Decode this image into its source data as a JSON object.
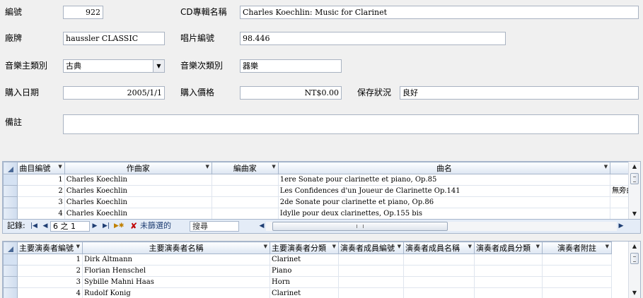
{
  "form": {
    "id_label": "編號",
    "id_value": "922",
    "album_label": "CD專輯名稱",
    "album_value": "Charles Koechlin: Music for Clarinet",
    "label_label": "廠牌",
    "label_value": "haussler CLASSIC",
    "catalog_label": "唱片編號",
    "catalog_value": "98.446",
    "genre_label": "音樂主類別",
    "genre_value": "古典",
    "subgenre_label": "音樂次類別",
    "subgenre_value": "器樂",
    "date_label": "購入日期",
    "date_value": "2005/1/1",
    "price_label": "購入價格",
    "price_value": "NT$0.00",
    "condition_label": "保存狀況",
    "condition_value": "良好",
    "notes_label": "備註",
    "notes_value": ""
  },
  "tracks": {
    "columns": [
      "曲目編號",
      "作曲家",
      "編曲家",
      "曲名",
      ""
    ],
    "rows": [
      {
        "no": "1",
        "composer": "Charles Koechlin",
        "arranger": "",
        "title": "1ere Sonate pour clarinette et piano, Op.85",
        "extra": ""
      },
      {
        "no": "2",
        "composer": "Charles Koechlin",
        "arranger": "",
        "title": "Les Confidences d'un Joueur de Clarinette Op.141",
        "extra": "無旁白"
      },
      {
        "no": "3",
        "composer": "Charles Koechlin",
        "arranger": "",
        "title": "2de Sonate pour clarinette et piano, Op.86",
        "extra": ""
      },
      {
        "no": "4",
        "composer": "Charles Koechlin",
        "arranger": "",
        "title": "Idylle pour deux clarinettes, Op.155 bis",
        "extra": ""
      }
    ],
    "nav": {
      "record_label": "記錄:",
      "position": "6 之 1",
      "filter_label": "未篩選的",
      "search_placeholder": "搜尋"
    }
  },
  "performers": {
    "columns": [
      "主要演奏者編號",
      "主要演奏者名稱",
      "主要演奏者分類",
      "演奏者成員編號",
      "演奏者成員名稱",
      "演奏者成員分類",
      "演奏者附註"
    ],
    "rows": [
      {
        "no": "1",
        "name": "Dirk Altmann",
        "category": "Clarinet"
      },
      {
        "no": "2",
        "name": "Florian Henschel",
        "category": "Piano"
      },
      {
        "no": "3",
        "name": "Sybille Mahni Haas",
        "category": "Horn"
      },
      {
        "no": "4",
        "name": "Rudolf Konig",
        "category": "Clarinet"
      }
    ]
  }
}
